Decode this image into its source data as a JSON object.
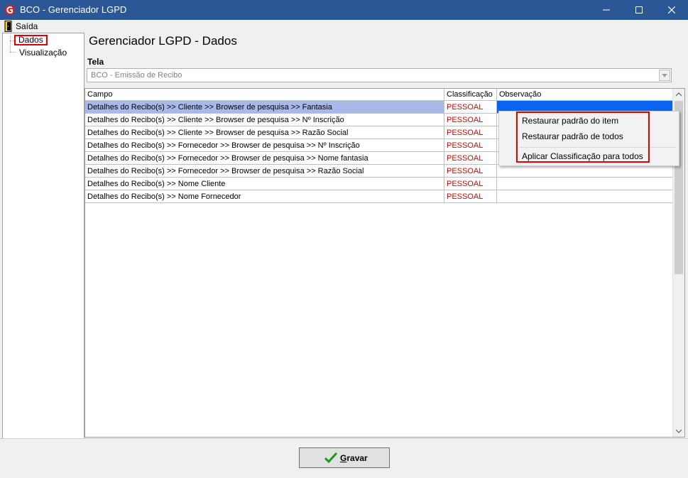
{
  "window": {
    "title": "BCO - Gerenciador LGPD"
  },
  "menu": {
    "exit_label": "Saída"
  },
  "tree": {
    "items": [
      {
        "label": "Dados"
      },
      {
        "label": "Visualização"
      }
    ]
  },
  "page": {
    "title": "Gerenciador LGPD - Dados"
  },
  "screen_select": {
    "label": "Tela",
    "value": "BCO - Emissão de Recibo"
  },
  "grid": {
    "columns": [
      "Campo",
      "Classificação",
      "Observação"
    ],
    "rows": [
      {
        "campo": "Detalhes do Recibo(s) >> Cliente >> Browser de pesquisa >> Fantasia",
        "classificacao": "PESSOAL",
        "observacao": ""
      },
      {
        "campo": "Detalhes do Recibo(s) >> Cliente >> Browser de pesquisa >> Nº Inscrição",
        "classificacao": "PESSOAL",
        "observacao": ""
      },
      {
        "campo": "Detalhes do Recibo(s) >> Cliente >> Browser de pesquisa >> Razão Social",
        "classificacao": "PESSOAL",
        "observacao": ""
      },
      {
        "campo": "Detalhes do Recibo(s) >> Fornecedor >> Browser de pesquisa >> Nº Inscrição",
        "classificacao": "PESSOAL",
        "observacao": ""
      },
      {
        "campo": "Detalhes do Recibo(s) >> Fornecedor >> Browser de pesquisa >> Nome fantasia",
        "classificacao": "PESSOAL",
        "observacao": ""
      },
      {
        "campo": "Detalhes do Recibo(s) >> Fornecedor >> Browser de pesquisa >> Razão Social",
        "classificacao": "PESSOAL",
        "observacao": ""
      },
      {
        "campo": "Detalhes do Recibo(s) >> Nome Cliente",
        "classificacao": "PESSOAL",
        "observacao": ""
      },
      {
        "campo": "Detalhes do Recibo(s) >> Nome Fornecedor",
        "classificacao": "PESSOAL",
        "observacao": ""
      }
    ]
  },
  "context_menu": {
    "items": [
      "Restaurar padrão do item",
      "Restaurar padrão de todos",
      "Aplicar Classificação para todos"
    ]
  },
  "save_button": {
    "label_first": "G",
    "label_rest": "ravar"
  },
  "colors": {
    "titlebar": "#2b5797",
    "selection": "#a8b8e8",
    "classification_text": "#d80000",
    "highlight_box": "#e00000"
  },
  "icons": [
    "app-logo-icon",
    "minimize-icon",
    "maximize-icon",
    "close-icon",
    "exit-door-icon",
    "checkmark-icon",
    "scroll-up-icon",
    "scroll-down-icon",
    "dropdown-arrow-icon"
  ]
}
